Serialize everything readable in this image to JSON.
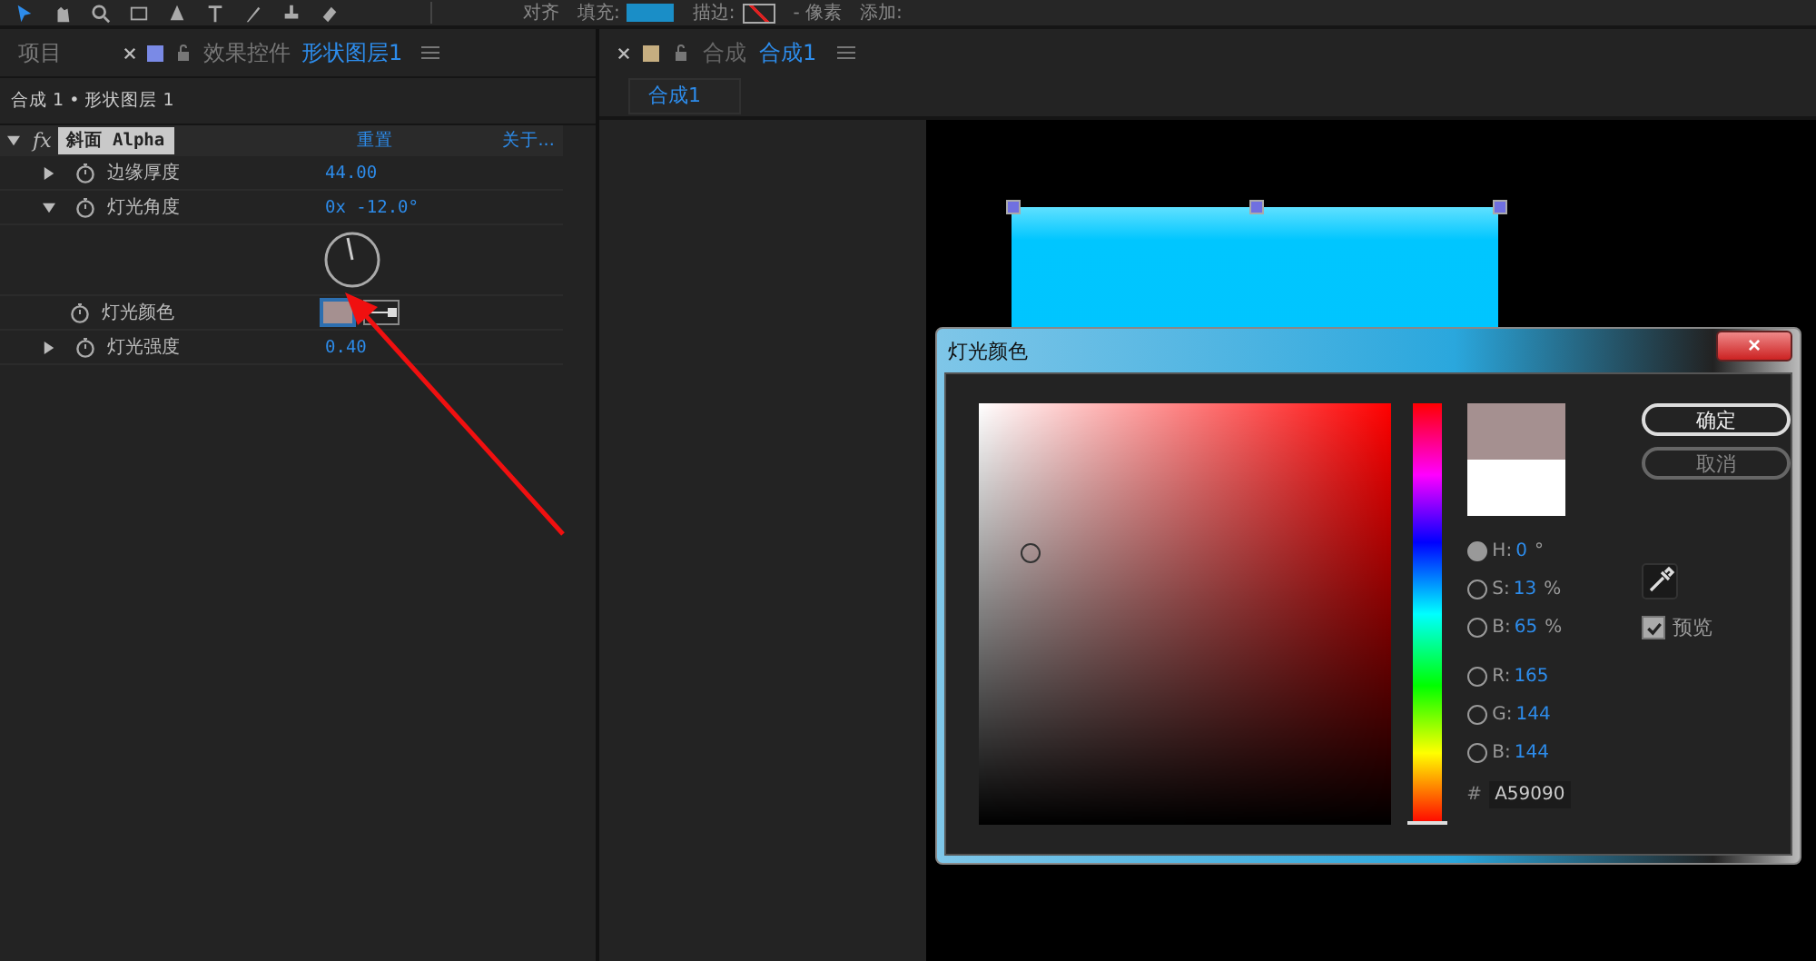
{
  "toolbar": {
    "items": [
      "对齐",
      "填充:",
      "描边:",
      "- 像素",
      "添加:"
    ]
  },
  "left_panel": {
    "tabs": [
      {
        "label": "项目",
        "selected": false
      },
      {
        "label": "效果控件",
        "selected": false
      },
      {
        "label": "形状图层1",
        "selected": true
      }
    ],
    "breadcrumb": "合成 1 • 形状图层 1",
    "effect": {
      "badge": "fx",
      "name": "斜面 Alpha",
      "reset": "重置",
      "about": "关于...",
      "expanded": true
    },
    "properties": [
      {
        "kind": "value",
        "label": "边缘厚度",
        "value": "44.00",
        "expanded": false
      },
      {
        "kind": "angle",
        "label": "灯光角度",
        "value": "0x -12.0°",
        "expanded": true
      },
      {
        "kind": "color",
        "label": "灯光颜色",
        "color": "#a59090"
      },
      {
        "kind": "value",
        "label": "灯光强度",
        "value": "0.40",
        "expanded": false
      }
    ]
  },
  "right_panel": {
    "tab_prefix": "合成",
    "tab_name": "合成1",
    "subtab": "合成1"
  },
  "dialog": {
    "title": "灯光颜色",
    "close": "×",
    "hue_slider": {
      "level": 0
    },
    "swatches": [
      {
        "color": "#a59090"
      },
      {
        "color": "#ffffff"
      }
    ],
    "buttons": [
      {
        "label": "确定",
        "kind": "primary"
      },
      {
        "label": "取消",
        "kind": "secondary"
      }
    ],
    "fields": [
      {
        "label": "H:",
        "value": "0",
        "unit": "°",
        "selected": true
      },
      {
        "label": "S:",
        "value": "13",
        "unit": "%",
        "selected": false
      },
      {
        "label": "B:",
        "value": "65",
        "unit": "%",
        "selected": false
      },
      {
        "label": "R:",
        "value": "165",
        "selected": false
      },
      {
        "label": "G:",
        "value": "144",
        "selected": false
      },
      {
        "label": "B:",
        "value": "144",
        "selected": false
      }
    ],
    "preview": {
      "label": "预览",
      "checked": true
    },
    "hex_label": "#",
    "hex_value": "A59090"
  }
}
